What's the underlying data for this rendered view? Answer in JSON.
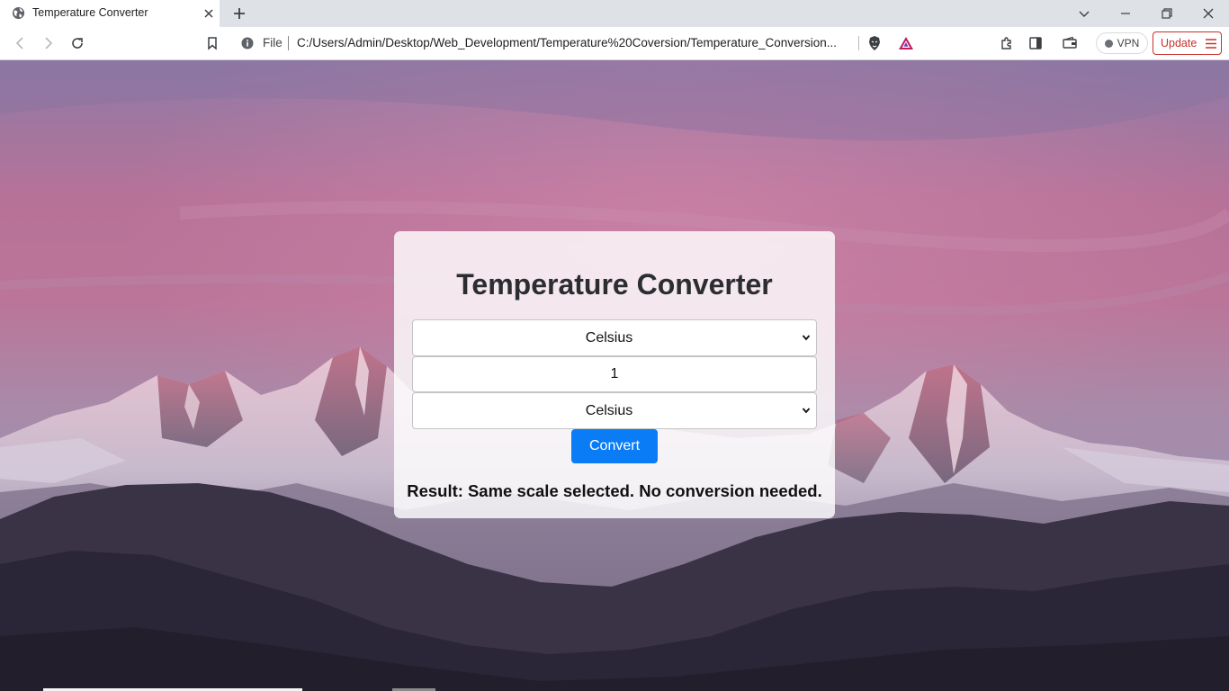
{
  "tab": {
    "title": "Temperature Converter",
    "icon": "globe-icon"
  },
  "toolbar": {
    "url_scheme_label": "File",
    "url": "C:/Users/Admin/Desktop/Web_Development/Temperature%20Coversion/Temperature_Conversion...",
    "vpn_label": "VPN",
    "update_label": "Update"
  },
  "converter": {
    "title": "Temperature Converter",
    "from_scale": "Celsius",
    "input_value": "1",
    "to_scale": "Celsius",
    "convert_label": "Convert",
    "result_label": "Result:",
    "result_text": "Same scale selected. No conversion needed."
  },
  "colors": {
    "accent": "#0a7cf5",
    "update_red": "#c9302c",
    "sky_top": "#8d7aa6",
    "sky_pink": "#c06e92"
  }
}
